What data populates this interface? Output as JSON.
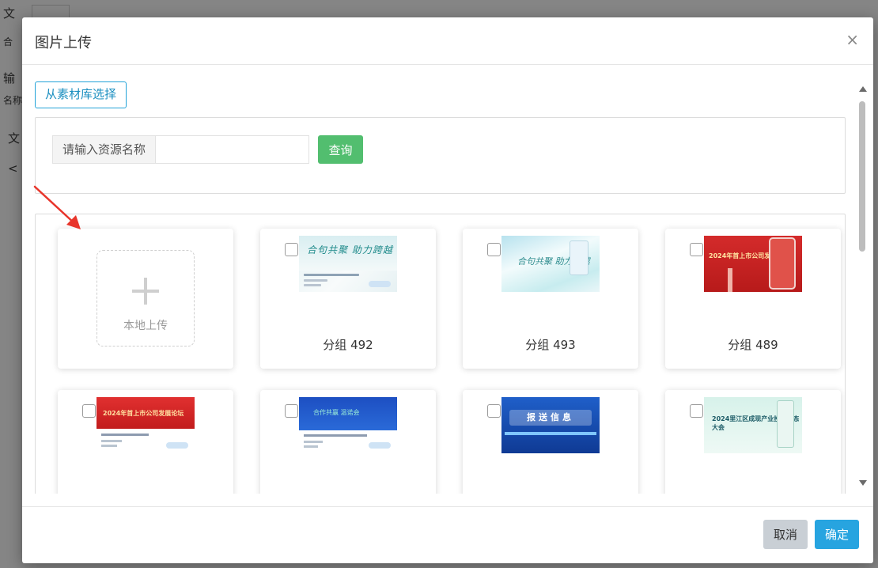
{
  "background": {
    "fragments": [
      "文",
      "合",
      "输",
      "名称",
      "文",
      "<"
    ]
  },
  "modal": {
    "title": "图片上传",
    "close_icon": "×",
    "from_library_label": "从素材库选择",
    "search": {
      "label": "请输入资源名称",
      "value": "",
      "placeholder": "",
      "button_label": "查询"
    },
    "upload_card": {
      "label": "本地上传",
      "icon": "plus-icon"
    },
    "items": [
      {
        "name": "分组 492",
        "thumb_text": "合句共聚 助力跨越",
        "style": "pale"
      },
      {
        "name": "分组 493",
        "thumb_text": "合句共聚 助力跨越",
        "style": "ice"
      },
      {
        "name": "分组 489",
        "thumb_text": "2024年首上市公司发展论坛",
        "style": "red"
      },
      {
        "name": "",
        "thumb_text": "2024年首上市公司发展论坛",
        "style": "redwhite"
      },
      {
        "name": "",
        "thumb_text": "合作共赢 温诺会",
        "style": "bluewhite"
      },
      {
        "name": "",
        "thumb_text": "报送信息",
        "style": "blue"
      },
      {
        "name": "",
        "thumb_text": "2024里江区成现产业投资生态大会",
        "style": "mint"
      }
    ],
    "footer": {
      "cancel_label": "取消",
      "ok_label": "确定"
    }
  },
  "colors": {
    "accent": "#27a4e0",
    "search_button": "#52be6f",
    "annotation_arrow": "#e8352b"
  }
}
